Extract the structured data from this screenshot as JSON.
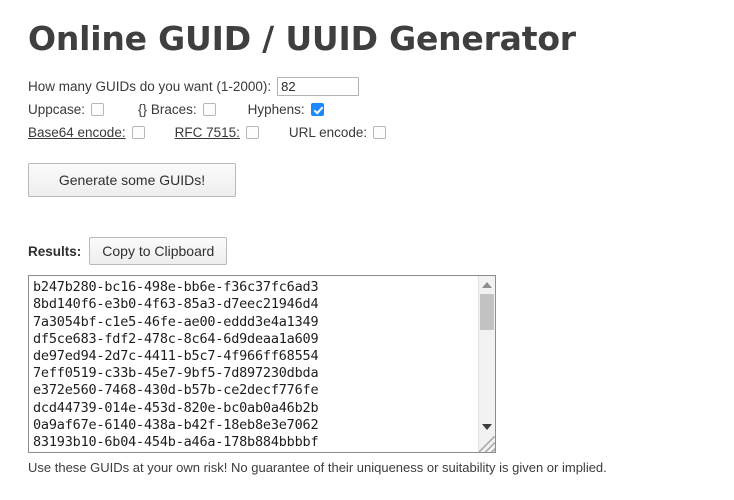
{
  "page_title": "Online GUID / UUID Generator",
  "form": {
    "count_label": "How many GUIDs do you want (1-2000):",
    "count_value": "82",
    "count_placeholder": "",
    "options": [
      {
        "label": "Uppcase:",
        "checked": false,
        "link": false
      },
      {
        "label": "{} Braces:",
        "checked": false,
        "link": false
      },
      {
        "label": "Hyphens:",
        "checked": true,
        "link": false
      },
      {
        "label": "Base64 encode:",
        "checked": false,
        "link": true
      },
      {
        "label": "RFC 7515:",
        "checked": false,
        "link": true
      },
      {
        "label": "URL encode:",
        "checked": false,
        "link": false
      }
    ],
    "generate_button": "Generate some GUIDs!"
  },
  "results": {
    "label": "Results:",
    "copy_button": "Copy to Clipboard",
    "guids": [
      "b247b280-bc16-498e-bb6e-f36c37fc6ad3",
      "8bd140f6-e3b0-4f63-85a3-d7eec21946d4",
      "7a3054bf-c1e5-46fe-ae00-eddd3e4a1349",
      "df5ce683-fdf2-478c-8c64-6d9deaa1a609",
      "de97ed94-2d7c-4411-b5c7-4f966ff68554",
      "7eff0519-c33b-45e7-9bf5-7d897230dbda",
      "e372e560-7468-430d-b57b-ce2decf776fe",
      "dcd44739-014e-453d-820e-bc0ab0a46b2b",
      "0a9af67e-6140-438a-b42f-18eb8e3e7062",
      "83193b10-6b04-454b-a46a-178b884bbbbf"
    ]
  },
  "footer": "Use these GUIDs at your own risk! No guarantee of their uniqueness or suitability is given or implied.",
  "colors": {
    "title": "#3f3f3f",
    "checkbox_checked": "#1a88ff",
    "text": "#3a3a3a",
    "textarea_border": "#8d8d8d"
  }
}
